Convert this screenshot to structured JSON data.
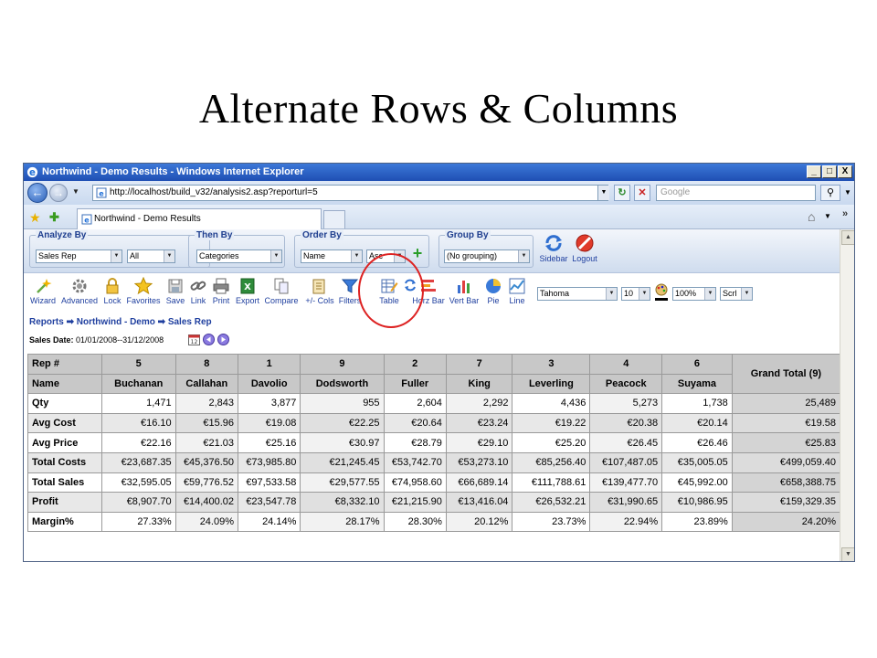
{
  "slide": {
    "title": "Alternate Rows & Columns"
  },
  "browser": {
    "window_title": "Northwind - Demo Results - Windows Internet Explorer",
    "url": "http://localhost/build_v32/analysis2.asp?reporturl=5",
    "search_placeholder": "Google",
    "tab_title": "Northwind - Demo Results",
    "min_label": "_",
    "max_label": "□",
    "close_label": "X"
  },
  "filters": {
    "analyze_by": {
      "label": "Analyze By",
      "value1": "Sales Rep",
      "value2": "All"
    },
    "then_by": {
      "label": "Then By",
      "value": "Categories"
    },
    "order_by": {
      "label": "Order By",
      "value1": "Name",
      "value2": "Asc"
    },
    "group_by": {
      "label": "Group By",
      "value": "(No grouping)"
    },
    "sidebar_label": "Sidebar",
    "logout_label": "Logout"
  },
  "toolbar": {
    "wizard": "Wizard",
    "advanced": "Advanced",
    "lock": "Lock",
    "favorites": "Favorites",
    "save": "Save",
    "link": "Link",
    "print": "Print",
    "export": "Export",
    "compare": "Compare",
    "cols": "+/- Cols",
    "filters": "Filters",
    "table": "Table",
    "horz_bar": "Horz Bar",
    "vert_bar": "Vert Bar",
    "pie": "Pie",
    "line": "Line",
    "font": "Tahoma",
    "font_size": "10",
    "zoom": "100%",
    "scroll": "Scrl"
  },
  "breadcrumb": {
    "reports": "Reports",
    "demo": "Northwind - Demo",
    "rep": "Sales Rep",
    "arrow": "➡"
  },
  "date_filter": {
    "label": "Sales Date:",
    "value": "01/01/2008--31/12/2008"
  },
  "table": {
    "rep_header": "Rep #",
    "name_header": "Name",
    "grand_total_header": "Grand Total (9)",
    "columns": [
      {
        "rep": "5",
        "name": "Buchanan"
      },
      {
        "rep": "8",
        "name": "Callahan"
      },
      {
        "rep": "1",
        "name": "Davolio"
      },
      {
        "rep": "9",
        "name": "Dodsworth"
      },
      {
        "rep": "2",
        "name": "Fuller"
      },
      {
        "rep": "7",
        "name": "King"
      },
      {
        "rep": "3",
        "name": "Leverling"
      },
      {
        "rep": "4",
        "name": "Peacock"
      },
      {
        "rep": "6",
        "name": "Suyama"
      }
    ],
    "rows": [
      {
        "label": "Qty",
        "values": [
          "1,471",
          "2,843",
          "3,877",
          "955",
          "2,604",
          "2,292",
          "4,436",
          "5,273",
          "1,738"
        ],
        "total": "25,489"
      },
      {
        "label": "Avg Cost",
        "values": [
          "€16.10",
          "€15.96",
          "€19.08",
          "€22.25",
          "€20.64",
          "€23.24",
          "€19.22",
          "€20.38",
          "€20.14"
        ],
        "total": "€19.58"
      },
      {
        "label": "Avg Price",
        "values": [
          "€22.16",
          "€21.03",
          "€25.16",
          "€30.97",
          "€28.79",
          "€29.10",
          "€25.20",
          "€26.45",
          "€26.46"
        ],
        "total": "€25.83"
      },
      {
        "label": "Total Costs",
        "values": [
          "€23,687.35",
          "€45,376.50",
          "€73,985.80",
          "€21,245.45",
          "€53,742.70",
          "€53,273.10",
          "€85,256.40",
          "€107,487.05",
          "€35,005.05"
        ],
        "total": "€499,059.40"
      },
      {
        "label": "Total Sales",
        "values": [
          "€32,595.05",
          "€59,776.52",
          "€97,533.58",
          "€29,577.55",
          "€74,958.60",
          "€66,689.14",
          "€111,788.61",
          "€139,477.70",
          "€45,992.00"
        ],
        "total": "€658,388.75"
      },
      {
        "label": "Profit",
        "values": [
          "€8,907.70",
          "€14,400.02",
          "€23,547.78",
          "€8,332.10",
          "€21,215.90",
          "€13,416.04",
          "€26,532.21",
          "€31,990.65",
          "€10,986.95"
        ],
        "total": "€159,329.35"
      },
      {
        "label": "Margin%",
        "values": [
          "27.33%",
          "24.09%",
          "24.14%",
          "28.17%",
          "28.30%",
          "20.12%",
          "23.73%",
          "22.94%",
          "23.89%"
        ],
        "total": "24.20%"
      }
    ]
  }
}
